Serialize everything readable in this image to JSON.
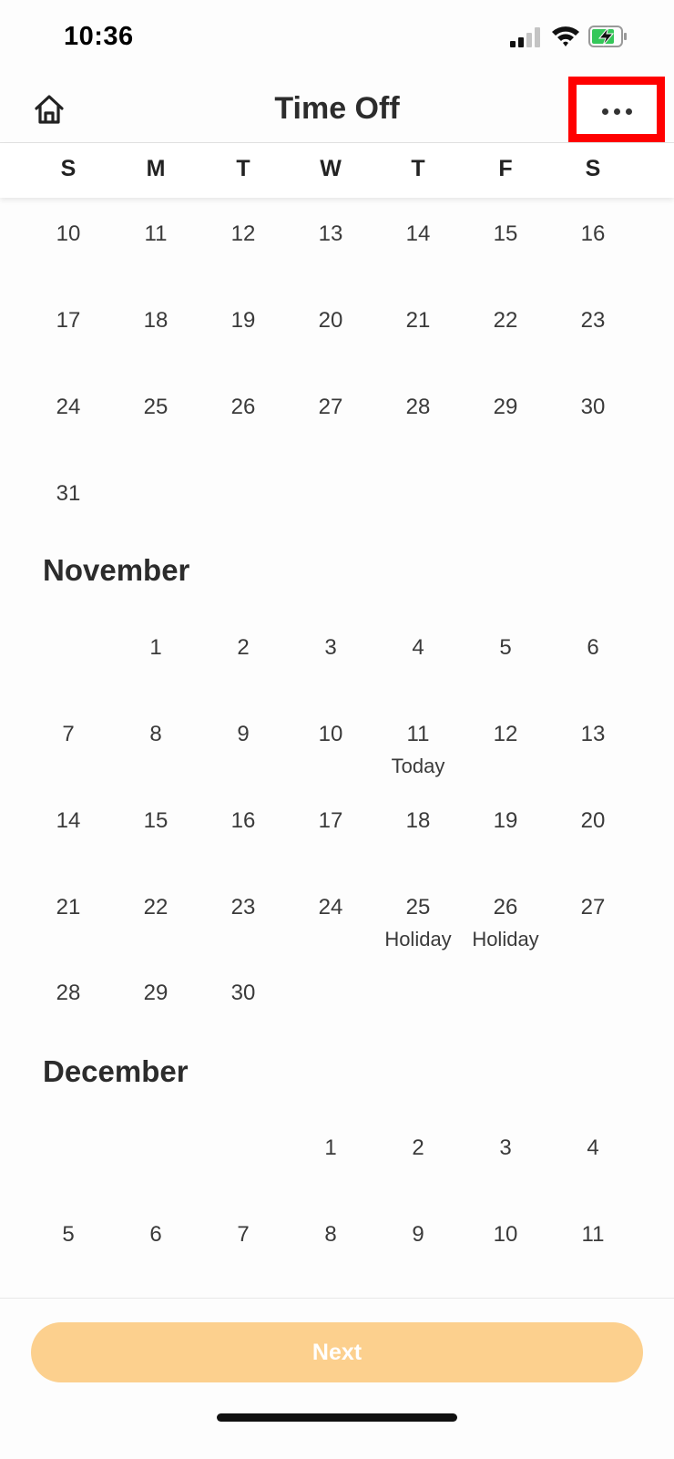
{
  "status_bar": {
    "time": "10:36"
  },
  "header": {
    "title": "Time Off"
  },
  "weekdays": [
    "S",
    "M",
    "T",
    "W",
    "T",
    "F",
    "S"
  ],
  "calendar": {
    "october_rows": [
      [
        "10",
        "11",
        "12",
        "13",
        "14",
        "15",
        "16"
      ],
      [
        "17",
        "18",
        "19",
        "20",
        "21",
        "22",
        "23"
      ],
      [
        "24",
        "25",
        "26",
        "27",
        "28",
        "29",
        "30"
      ],
      [
        "31",
        "",
        "",
        "",
        "",
        "",
        ""
      ]
    ],
    "months": [
      {
        "name": "November",
        "rows": [
          [
            "",
            "1",
            "2",
            "3",
            "4",
            "5",
            "6"
          ],
          [
            "7",
            "8",
            "9",
            "10",
            "11",
            "12",
            "13"
          ],
          [
            "14",
            "15",
            "16",
            "17",
            "18",
            "19",
            "20"
          ],
          [
            "21",
            "22",
            "23",
            "24",
            "25",
            "26",
            "27"
          ],
          [
            "28",
            "29",
            "30",
            "",
            "",
            "",
            ""
          ]
        ],
        "notes": [
          {
            "day": "11",
            "label": "Today"
          },
          {
            "day": "25",
            "label": "Holiday"
          },
          {
            "day": "26",
            "label": "Holiday"
          }
        ]
      },
      {
        "name": "December",
        "rows": [
          [
            "",
            "",
            "",
            "1",
            "2",
            "3",
            "4"
          ],
          [
            "5",
            "6",
            "7",
            "8",
            "9",
            "10",
            "11"
          ]
        ],
        "notes": []
      }
    ]
  },
  "footer": {
    "next_label": "Next"
  },
  "colors": {
    "accent": "#fcd08e",
    "highlight": "#ff0000"
  },
  "icons": {
    "home": "home-icon",
    "more": "more-horizontal-icon"
  }
}
